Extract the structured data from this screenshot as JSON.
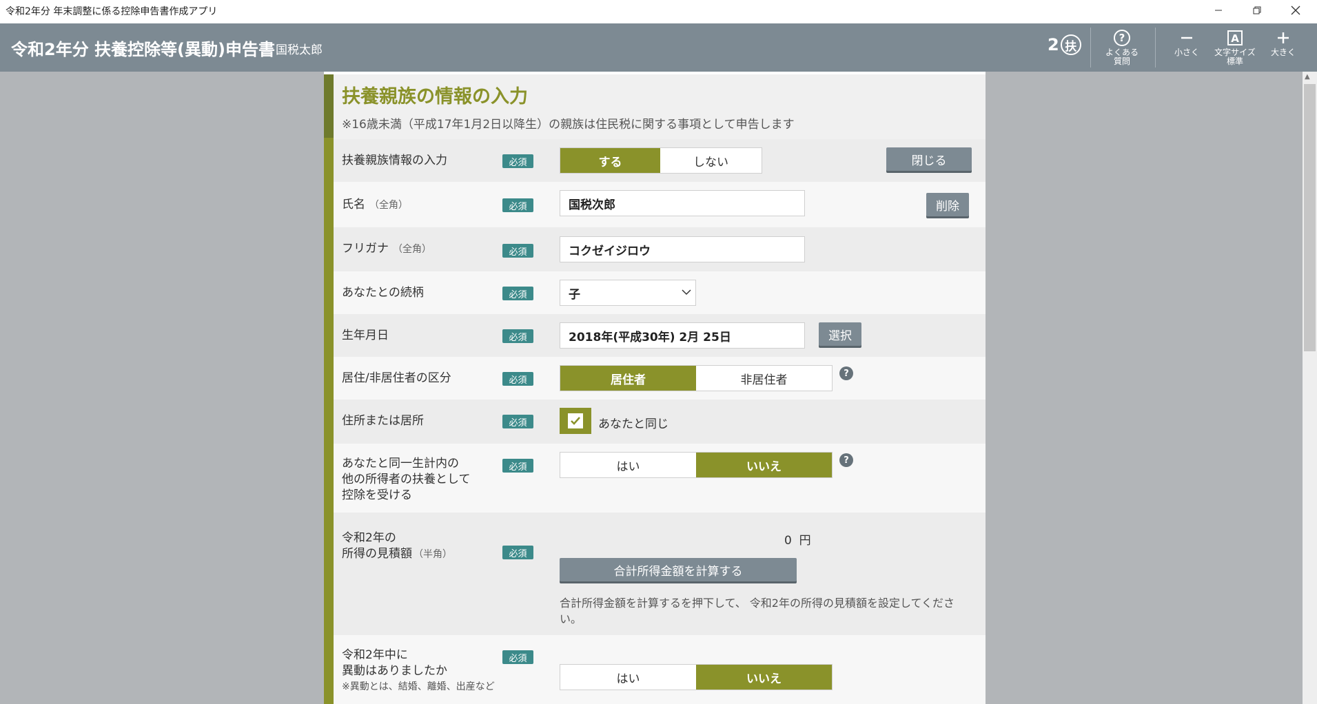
{
  "window": {
    "title": "令和2年分 年末調整に係る控除申告書作成アプリ"
  },
  "header": {
    "title": "令和2年分 扶養控除等(異動)申告書",
    "user": "国税太郎",
    "badge_num": "2",
    "badge_char": "扶",
    "faq_label_1": "よくある",
    "faq_label_2": "質問",
    "smaller_label": "小さく",
    "fontsize_label_1": "文字サイズ",
    "fontsize_label_2": "標準",
    "larger_label": "大きく"
  },
  "section": {
    "title": "扶養親族の情報の入力",
    "note": "※16歳未満（平成17年1月2日以降生）の親族は住民税に関する事項として申告します"
  },
  "required_label": "必須",
  "rows": {
    "input": {
      "label": "扶養親族情報の入力",
      "yes": "する",
      "no": "しない",
      "close": "閉じる"
    },
    "name": {
      "label": "氏名",
      "hint": "（全角）",
      "value": "国税次郎",
      "delete": "削除"
    },
    "kana": {
      "label": "フリガナ",
      "hint": "（全角）",
      "value": "コクゼイジロウ"
    },
    "relation": {
      "label": "あなたとの続柄",
      "value": "子"
    },
    "birth": {
      "label": "生年月日",
      "value": "2018年(平成30年) 2月 25日",
      "select": "選択"
    },
    "residency": {
      "label": "居住/非居住者の区分",
      "yes": "居住者",
      "no": "非居住者"
    },
    "address": {
      "label": "住所または居所",
      "checkbox_label": "あなたと同じ"
    },
    "other_dependent": {
      "label_1": "あなたと同一生計内の",
      "label_2": "他の所得者の扶養として",
      "label_3": "控除を受ける",
      "yes": "はい",
      "no": "いいえ"
    },
    "income": {
      "label_1": "令和2年の",
      "label_2": "所得の見積額",
      "hint": "（半角）",
      "amount": "0",
      "unit": "円",
      "calc_button": "合計所得金額を計算する",
      "calc_note": "合計所得金額を計算するを押下して、 令和2年の所得の見積額を設定してください。"
    },
    "change": {
      "label_1": "令和2年中に",
      "label_2": "異動はありましたか",
      "note": "※異動とは、結婚、離婚、出産など",
      "yes": "はい",
      "no": "いいえ"
    }
  }
}
